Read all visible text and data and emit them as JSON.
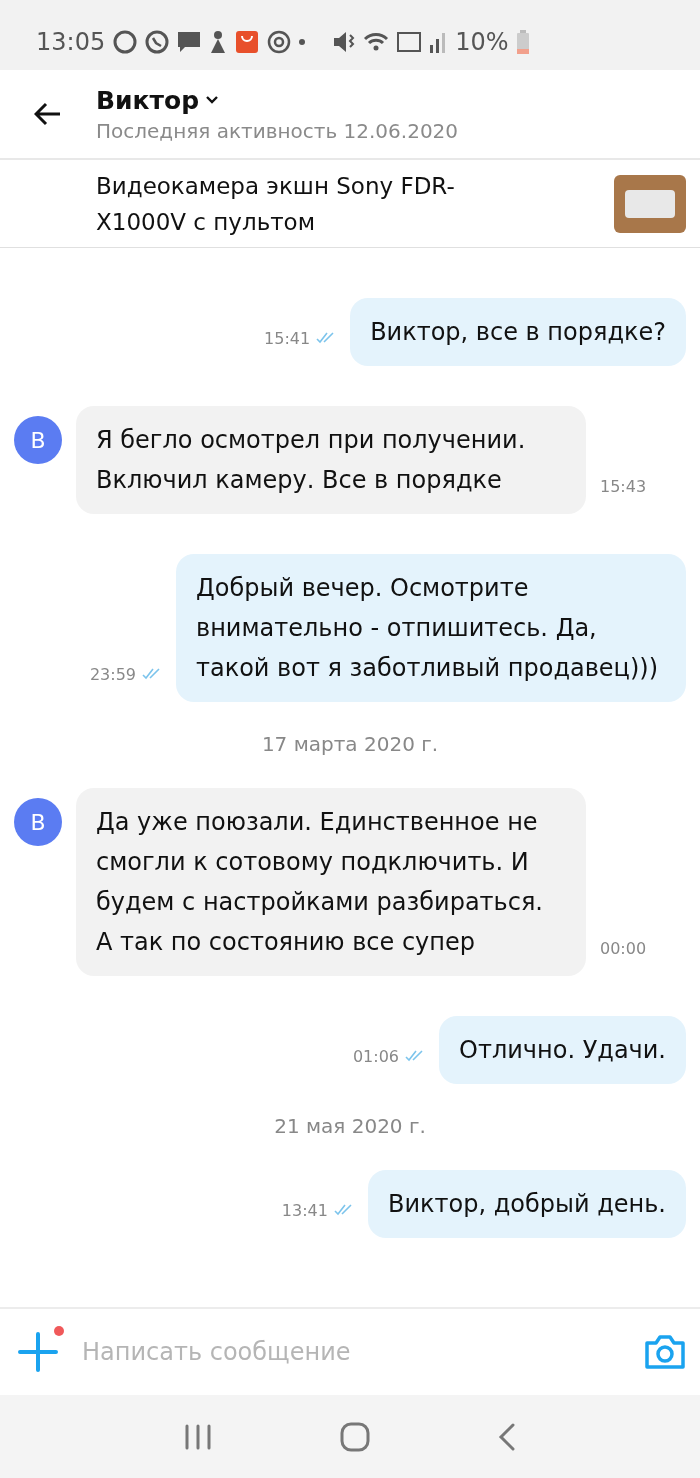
{
  "status_bar": {
    "time": "13:05",
    "battery": "10%"
  },
  "header": {
    "name": "Виктор",
    "last_seen": "Последняя активность 12.06.2020"
  },
  "product": {
    "title": "Видеокамера экшн Sony FDR-X1000V с пультом"
  },
  "messages": [
    {
      "kind": "outgoing",
      "text": "Виктор, все в порядке?",
      "time": "15:41",
      "read": true
    },
    {
      "kind": "incoming",
      "avatar": "В",
      "text": "Я бегло осмотрел при получении. Включил камеру. Все в порядке",
      "time": "15:43"
    },
    {
      "kind": "outgoing",
      "text": "Добрый вечер. Осмотрите внимательно - отпишитесь. Да, такой вот я заботливый продавец)))",
      "time": "23:59",
      "read": true
    },
    {
      "kind": "date",
      "text": "17 марта 2020 г."
    },
    {
      "kind": "incoming",
      "avatar": "В",
      "text": "Да уже поюзали. Единственное не смогли к сотовому подключить. И будем с настройками разбираться. А так по состоянию все супер",
      "time": "00:00"
    },
    {
      "kind": "outgoing",
      "text": "Отлично. Удачи.",
      "time": "01:06",
      "read": true
    },
    {
      "kind": "date",
      "text": "21 мая 2020 г."
    },
    {
      "kind": "outgoing",
      "text": "Виктор, добрый день.",
      "time": "13:41",
      "read": true
    }
  ],
  "composer": {
    "placeholder": "Написать сообщение",
    "attach_badge": true
  }
}
